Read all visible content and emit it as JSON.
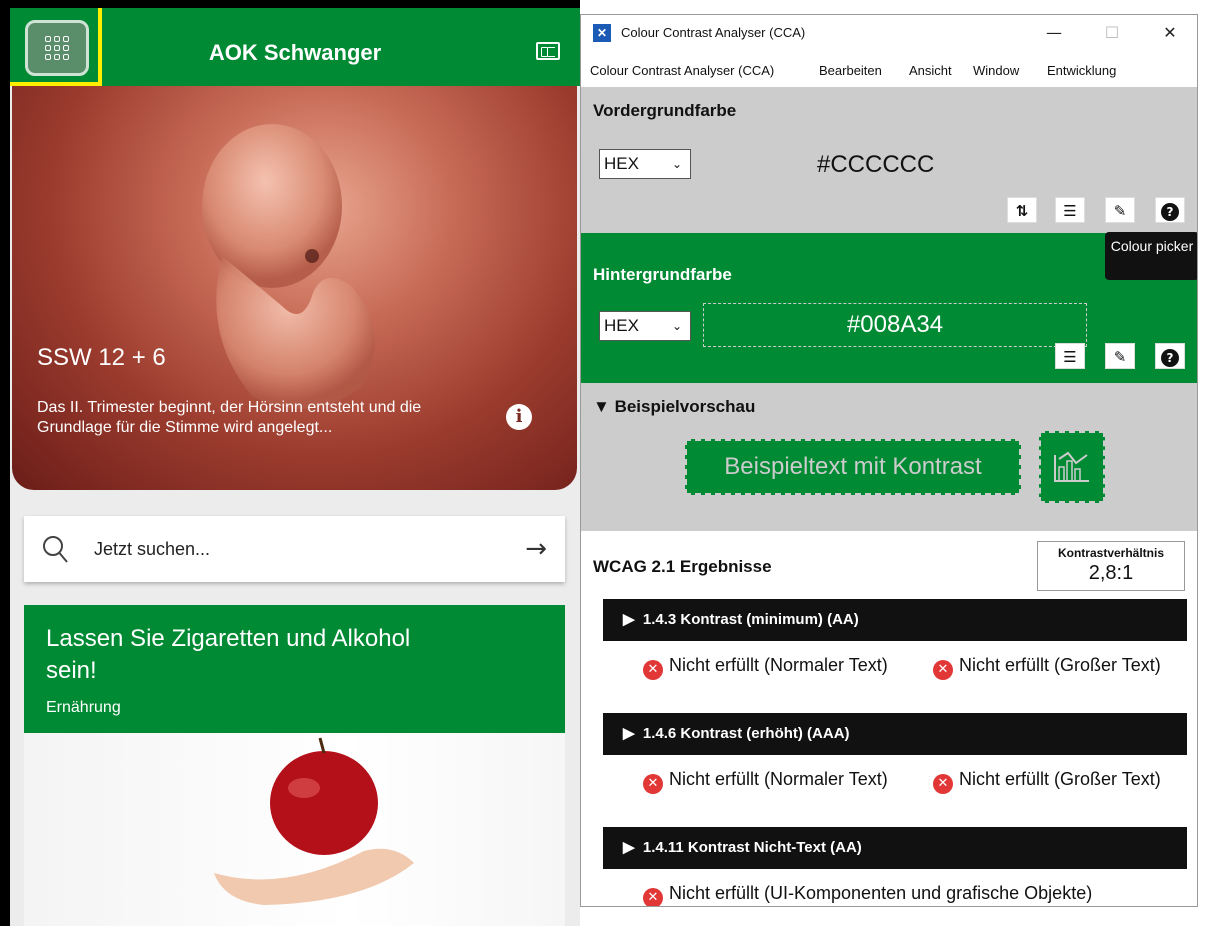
{
  "aok": {
    "title": "AOK Schwanger",
    "hero": {
      "week": "SSW 12 + 6",
      "text": "Das II. Trimester beginnt, der Hörsinn entsteht und die Grundlage für die Stimme wird angelegt..."
    },
    "search": {
      "placeholder": "Jetzt suchen..."
    },
    "article": {
      "title": "Lassen Sie Zigaretten und Alkohol sein!",
      "category": "Ernährung"
    },
    "colors": {
      "brand_green": "#008a34",
      "highlight": "#ffee00"
    }
  },
  "cca": {
    "window_title": "Colour Contrast Analyser (CCA)",
    "menu": [
      "Colour Contrast Analyser (CCA)",
      "Bearbeiten",
      "Ansicht",
      "Window",
      "Entwicklung"
    ],
    "foreground": {
      "title": "Vordergrundfarbe",
      "format": "HEX",
      "value": "#CCCCCC"
    },
    "background": {
      "title": "Hintergrundfarbe",
      "format": "HEX",
      "value": "#008A34"
    },
    "tooltip": "Colour picker",
    "preview": {
      "title": "Beispielvorschau",
      "sample": "Beispieltext mit Kontrast"
    },
    "results": {
      "title": "WCAG 2.1 Ergebnisse",
      "ratio_label": "Kontrastverhältnis",
      "ratio_value": "2,8:1",
      "criteria": [
        {
          "label": "1.4.3 Kontrast (minimum) (AA)",
          "result_normal": "Nicht erfüllt (Normaler Text)",
          "result_large": "Nicht erfüllt (Großer Text)"
        },
        {
          "label": "1.4.6 Kontrast (erhöht) (AAA)",
          "result_normal": "Nicht erfüllt (Normaler Text)",
          "result_large": "Nicht erfüllt (Großer Text)"
        },
        {
          "label": "1.4.11 Kontrast Nicht-Text (AA)",
          "result_ui": "Nicht erfüllt (UI-Komponenten und grafische Objekte)"
        }
      ]
    }
  }
}
